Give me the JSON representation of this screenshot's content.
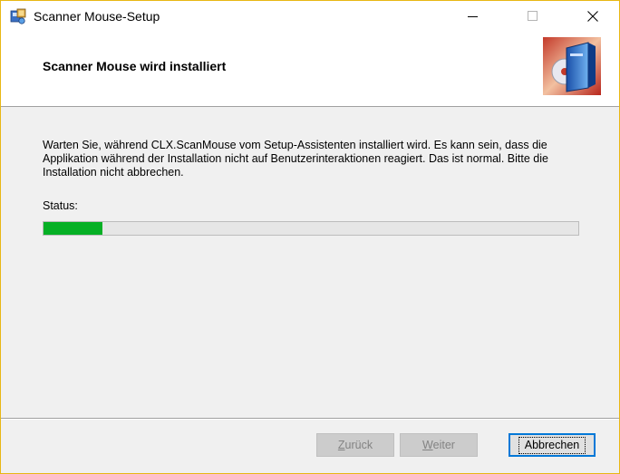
{
  "window": {
    "title": "Scanner Mouse-Setup",
    "controls": {
      "minimize_icon": "minimize-icon",
      "maximize_icon": "maximize-icon",
      "close_icon": "close-icon"
    }
  },
  "banner": {
    "title": "Scanner Mouse wird installiert",
    "image_icon": "installer-box-icon"
  },
  "content": {
    "description": "Warten Sie, während CLX.ScanMouse vom Setup-Assistenten installiert wird. Es kann sein, dass die Applikation während der Installation nicht auf Benutzerinteraktionen reagiert. Das ist normal. Bitte die Installation nicht abbrechen.",
    "status_label": "Status:",
    "progress_percent": 11
  },
  "buttons": {
    "back": {
      "first": "Z",
      "rest": "urück",
      "enabled": false
    },
    "next": {
      "first": "W",
      "rest": "eiter",
      "enabled": false
    },
    "cancel": {
      "label": "Abbrechen",
      "enabled": true
    }
  },
  "colors": {
    "accent": "#0078d7",
    "progress": "#06b025",
    "window_border": "#e8b714"
  }
}
